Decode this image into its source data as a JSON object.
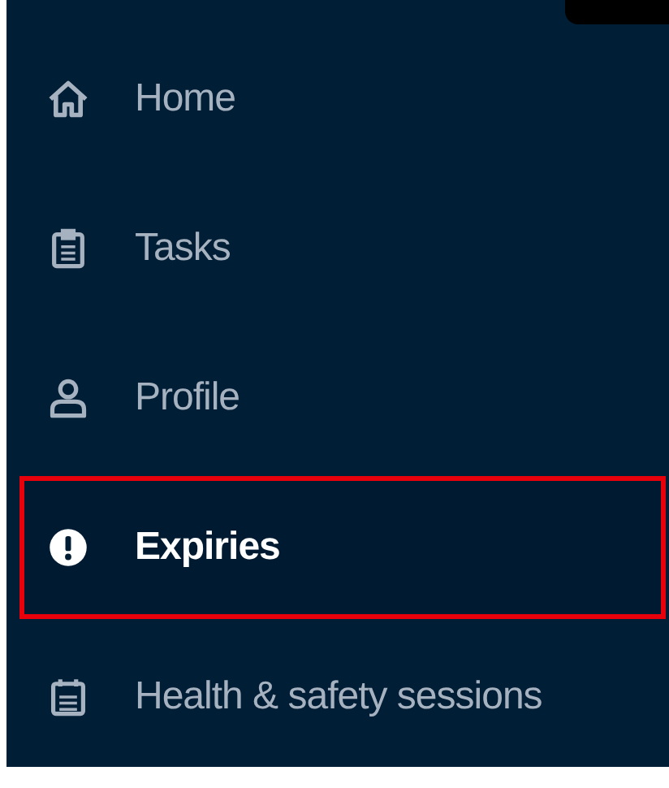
{
  "sidebar": {
    "items": [
      {
        "label": "Home",
        "selected": false
      },
      {
        "label": "Tasks",
        "selected": false
      },
      {
        "label": "Profile",
        "selected": false
      },
      {
        "label": "Expiries",
        "selected": true
      },
      {
        "label": "Health & safety sessions",
        "selected": false
      }
    ]
  }
}
